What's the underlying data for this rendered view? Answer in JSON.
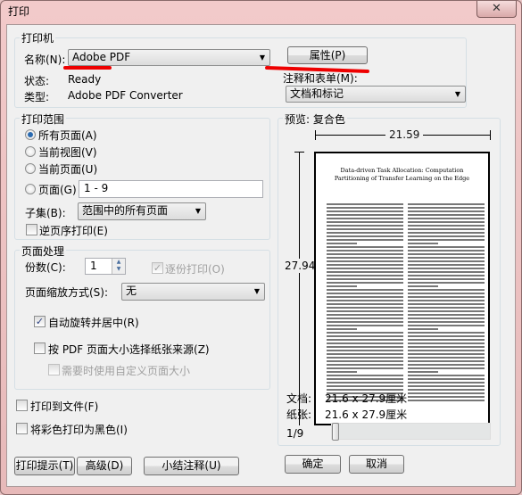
{
  "window": {
    "title": "打印",
    "close_icon": "close-icon"
  },
  "printer": {
    "group": "打印机",
    "name_label": "名称(N):",
    "name_value": "Adobe PDF",
    "properties": "属性(P)",
    "status_label": "状态:",
    "status_value": "Ready",
    "type_label": "类型:",
    "type_value": "Adobe PDF Converter",
    "comments_label": "注释和表单(M):",
    "comments_value": "文档和标记"
  },
  "range": {
    "group": "打印范围",
    "options": [
      "所有页面(A)",
      "当前视图(V)",
      "当前页面(U)",
      "页面(G)"
    ],
    "selected": 0,
    "pages_value": "1 - 9",
    "subset_label": "子集(B):",
    "subset_value": "范围中的所有页面",
    "reverse": "逆页序打印(E)",
    "reverse_checked": false
  },
  "handling": {
    "group": "页面处理",
    "copies_label": "份数(C):",
    "copies_value": "1",
    "collate": "逐份打印(O)",
    "collate_checked": true,
    "collate_disabled": true,
    "scaling_label": "页面缩放方式(S):",
    "scaling_value": "无",
    "auto_rotate": "自动旋转并居中(R)",
    "auto_rotate_checked": true,
    "paper_source": "按 PDF 页面大小选择纸张来源(Z)",
    "paper_source_checked": false,
    "custom_size": "需要时使用自定义页面大小",
    "custom_size_checked": false
  },
  "print_to_file": "打印到文件(F)",
  "print_black": "将彩色打印为黑色(I)",
  "preview": {
    "group": "预览: 复合色",
    "width": "21.59",
    "height": "27.94",
    "doc_title": [
      "Data-driven Task Allocation: Computation",
      "Partitioning of Transfer Learning on the Edge"
    ],
    "doc_label": "文档:",
    "doc_value": "21.6 x 27.9厘米",
    "paper_label": "纸张:",
    "paper_value": "21.6 x 27.9厘米",
    "page_indicator": "1/9",
    "slider_position": 0
  },
  "buttons": {
    "tips": "打印提示(T)",
    "advanced": "高级(D)",
    "summarize": "小结注释(U)",
    "ok": "确定",
    "cancel": "取消"
  },
  "colors": {
    "accent": "#2a6ab0",
    "annotation": "#ee0000"
  }
}
